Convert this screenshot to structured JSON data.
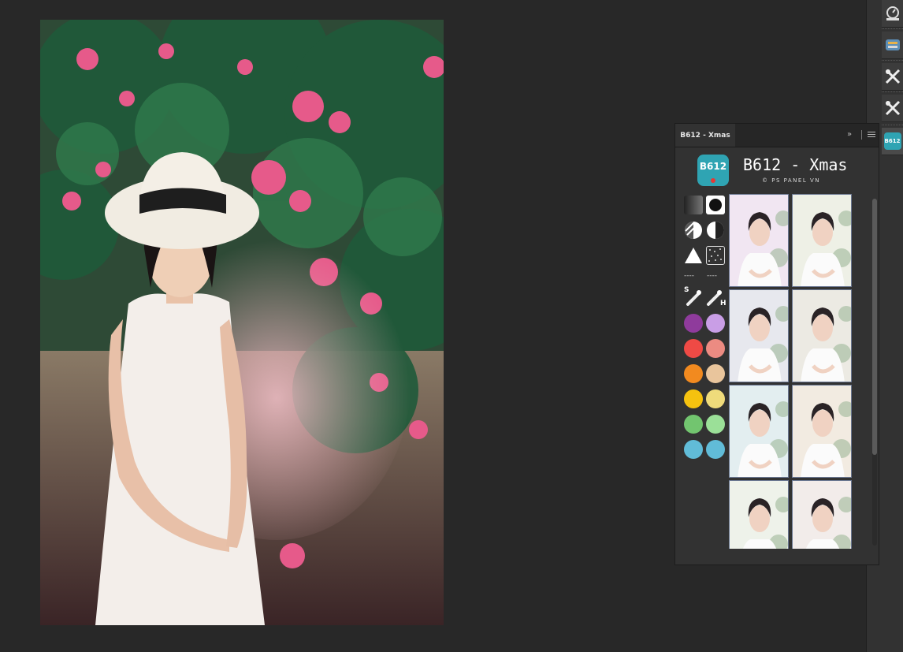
{
  "panel": {
    "tab_label": "B612 - Xmas",
    "title": "B612 - Xmas",
    "subtitle": "© PS PANEL VN",
    "logo_text": "B612",
    "tools": [
      {
        "name": "gradient-tool-icon"
      },
      {
        "name": "vignette-circle-icon"
      },
      {
        "name": "contrast-stripe-icon"
      },
      {
        "name": "contrast-half-icon"
      },
      {
        "name": "sharpen-triangle-icon"
      },
      {
        "name": "noise-texture-icon"
      }
    ],
    "dividers": [
      "----",
      "----"
    ],
    "brush_labels": {
      "left": "S",
      "right": "H"
    },
    "swatches": [
      [
        "#8f3b9c",
        "#c99ee6"
      ],
      [
        "#ef4a45",
        "#ec8b82"
      ],
      [
        "#f28a1f",
        "#e9c59c"
      ],
      [
        "#f5c20f",
        "#efdb7b"
      ],
      [
        "#72c56f",
        "#9be098"
      ],
      [
        "#61bcd8",
        "#61bcd8"
      ]
    ],
    "thumbnails": [
      {
        "name": "preset-1",
        "tint": "#f1e6f2"
      },
      {
        "name": "preset-2",
        "tint": "#eef0e6"
      },
      {
        "name": "preset-3",
        "tint": "#e7e8ee"
      },
      {
        "name": "preset-4",
        "tint": "#eceae3"
      },
      {
        "name": "preset-5",
        "tint": "#e3eef0"
      },
      {
        "name": "preset-6",
        "tint": "#f2ebe1"
      },
      {
        "name": "preset-7",
        "tint": "#eef2ea"
      },
      {
        "name": "preset-8",
        "tint": "#f2ecea"
      }
    ]
  },
  "dock_icons": [
    "adjustments-dial-icon",
    "channels-icon",
    "tools-crossed-icon",
    "tools-crossed-icon-2",
    "b612-panel-icon"
  ],
  "dock_badge": "B612",
  "colors": {
    "background": "#282828",
    "panel": "#323232",
    "accent": "#2fa4b3"
  }
}
